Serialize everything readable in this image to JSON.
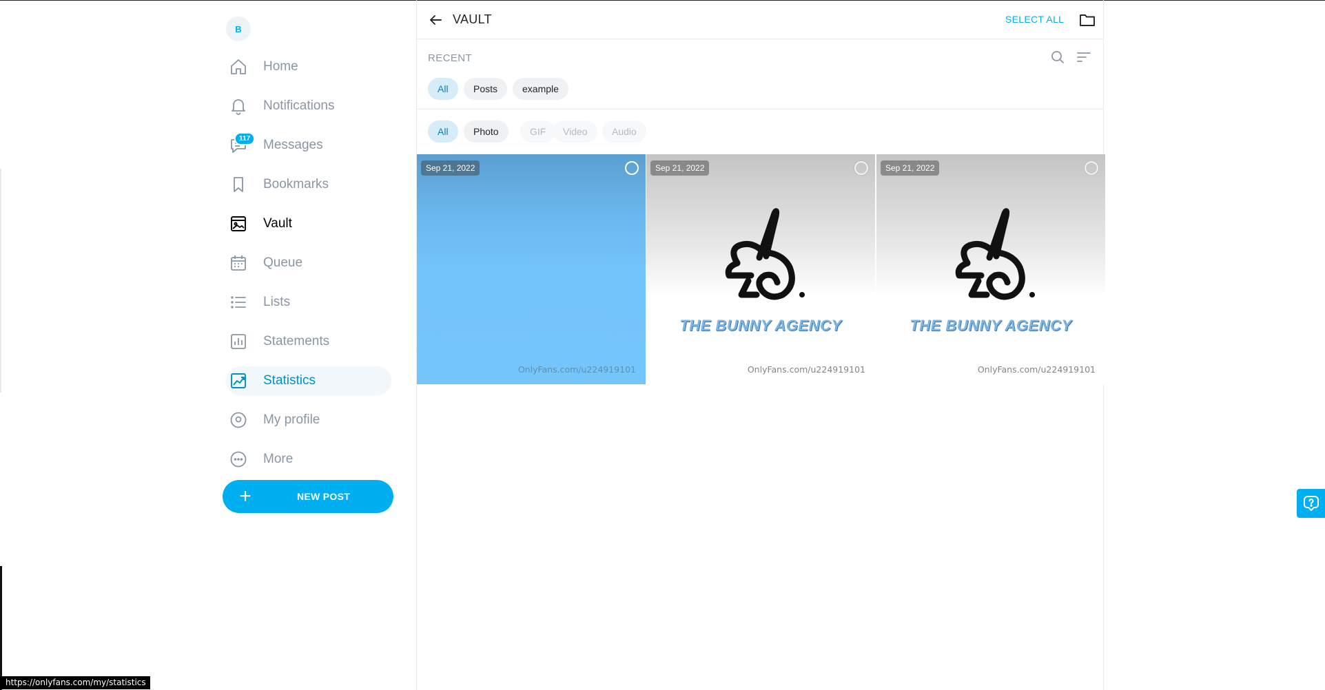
{
  "sidebar": {
    "avatar_initial": "B",
    "items": [
      {
        "label": "Home",
        "icon": "home-icon"
      },
      {
        "label": "Notifications",
        "icon": "bell-icon"
      },
      {
        "label": "Messages",
        "icon": "chat-icon",
        "badge": "117"
      },
      {
        "label": "Bookmarks",
        "icon": "bookmark-icon"
      },
      {
        "label": "Vault",
        "icon": "vault-icon"
      },
      {
        "label": "Queue",
        "icon": "calendar-icon"
      },
      {
        "label": "Lists",
        "icon": "list-icon"
      },
      {
        "label": "Statements",
        "icon": "statements-icon"
      },
      {
        "label": "Statistics",
        "icon": "chart-icon"
      },
      {
        "label": "My profile",
        "icon": "profile-icon"
      },
      {
        "label": "More",
        "icon": "more-icon"
      }
    ],
    "new_post_label": "NEW POST"
  },
  "header": {
    "title": "VAULT",
    "select_all": "SELECT ALL"
  },
  "recent": {
    "label": "RECENT",
    "filters": [
      "All",
      "Posts",
      "example"
    ]
  },
  "media_types": [
    "All",
    "Photo",
    "GIF",
    "Video",
    "Audio"
  ],
  "media": [
    {
      "date": "Sep 21, 2022",
      "watermark": "OnlyFans.com/u224919101",
      "kind": "blue"
    },
    {
      "date": "Sep 21, 2022",
      "watermark": "OnlyFans.com/u224919101",
      "kind": "bunny",
      "logo_text": "THE BUNNY AGENCY"
    },
    {
      "date": "Sep 21, 2022",
      "watermark": "OnlyFans.com/u224919101",
      "kind": "bunny",
      "logo_text": "THE BUNNY AGENCY"
    }
  ],
  "status_url": "https://onlyfans.com/my/statistics",
  "colors": {
    "accent": "#00aff0",
    "muted": "#8a96a3"
  }
}
